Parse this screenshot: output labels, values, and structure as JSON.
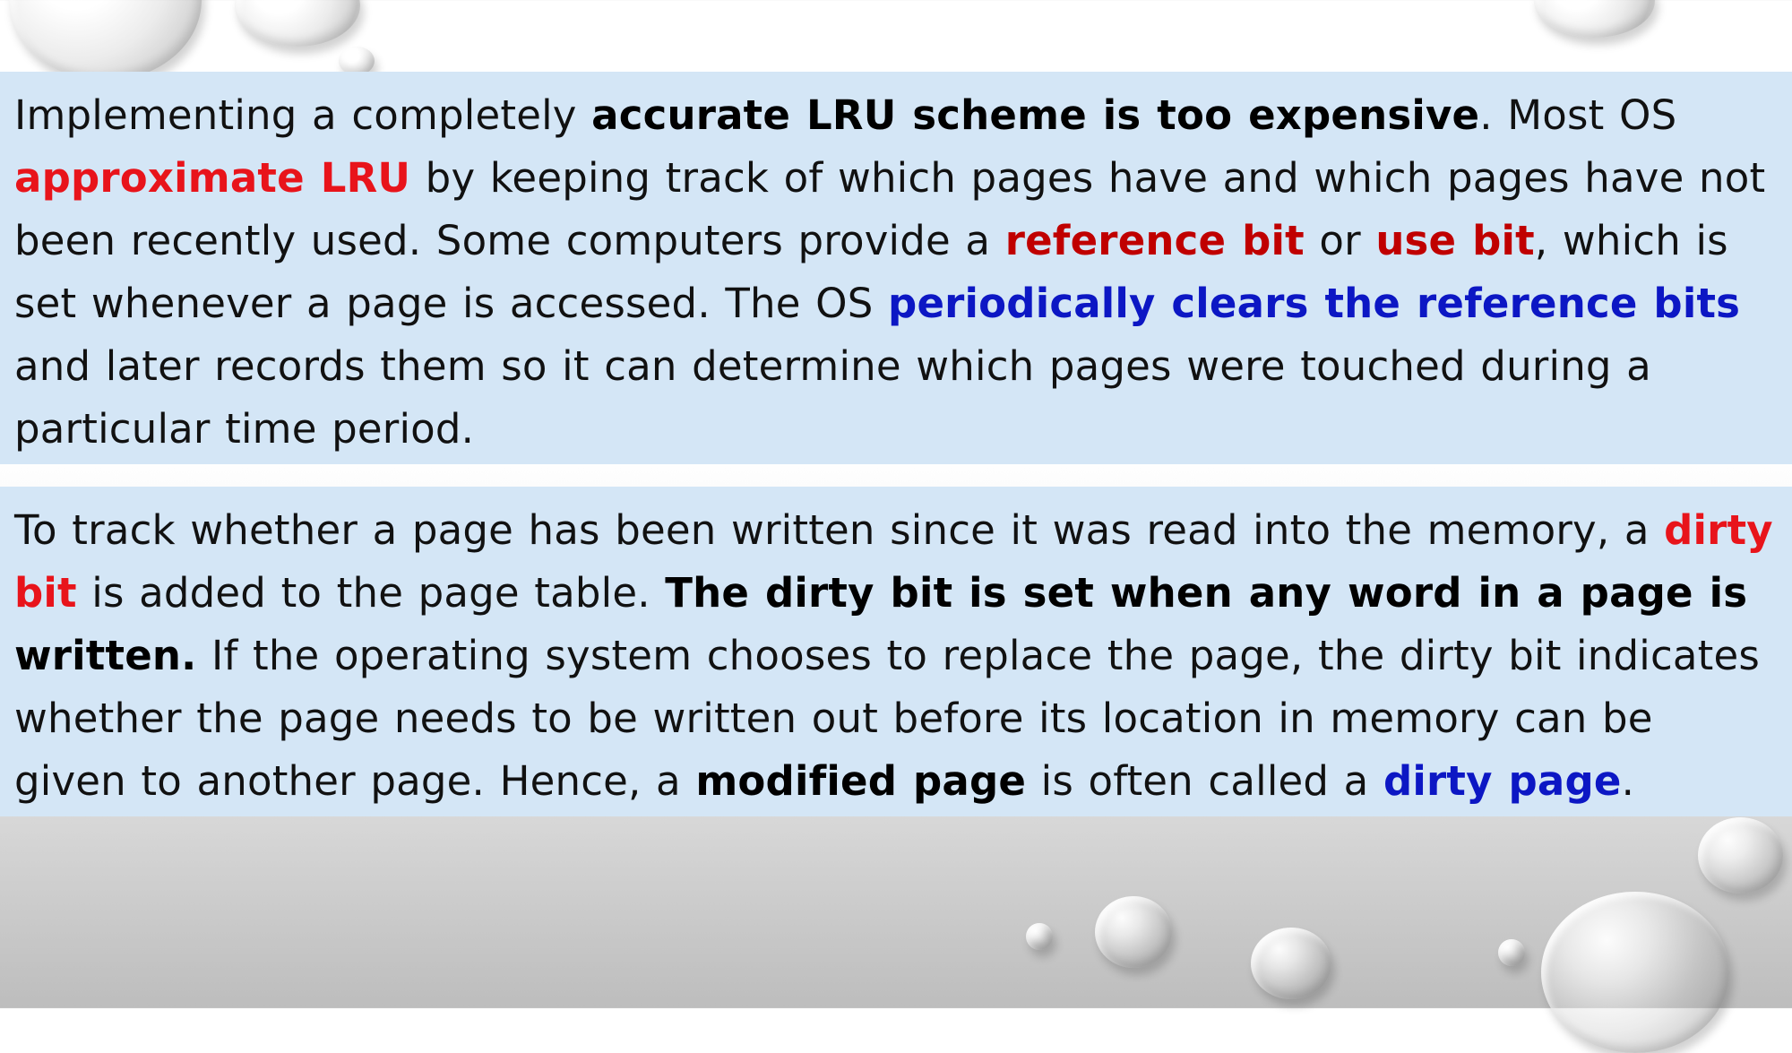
{
  "slide": {
    "paragraph1": {
      "t1": "Implementing a completely ",
      "k1": "accurate LRU scheme is too expensive",
      "t2": ". Most OS ",
      "k2": "approximate LRU",
      "t3": " by keeping track of which pages have and which pages have not been recently used. Some computers provide a ",
      "k3": "reference bit",
      "t4": " or ",
      "k4": "use bit",
      "t5": ", which is set whenever a page is accessed. The OS ",
      "k5": "periodically clears the reference bits",
      "t6": " and later records them so it can determine which pages were touched during a particular time period."
    },
    "paragraph2": {
      "t1": "To track whether a page has been written since it was read into the memory, a ",
      "k1": "dirty bit",
      "t2": " is added to the page table. ",
      "k2": "The dirty bit is set when any word in a page is written.",
      "t3": " If the operating system chooses to replace the page, the dirty bit indicates whether the page needs to be written out before its location in memory can be given to another page. Hence, a ",
      "k3": "modified page",
      "t4": " is often called a ",
      "k4": "dirty page",
      "t5": "."
    }
  },
  "colors": {
    "band": "#d4e6f6",
    "red_keyword": "#e8141b",
    "dark_red_keyword": "#c00000",
    "blue_keyword": "#0c17c4"
  }
}
